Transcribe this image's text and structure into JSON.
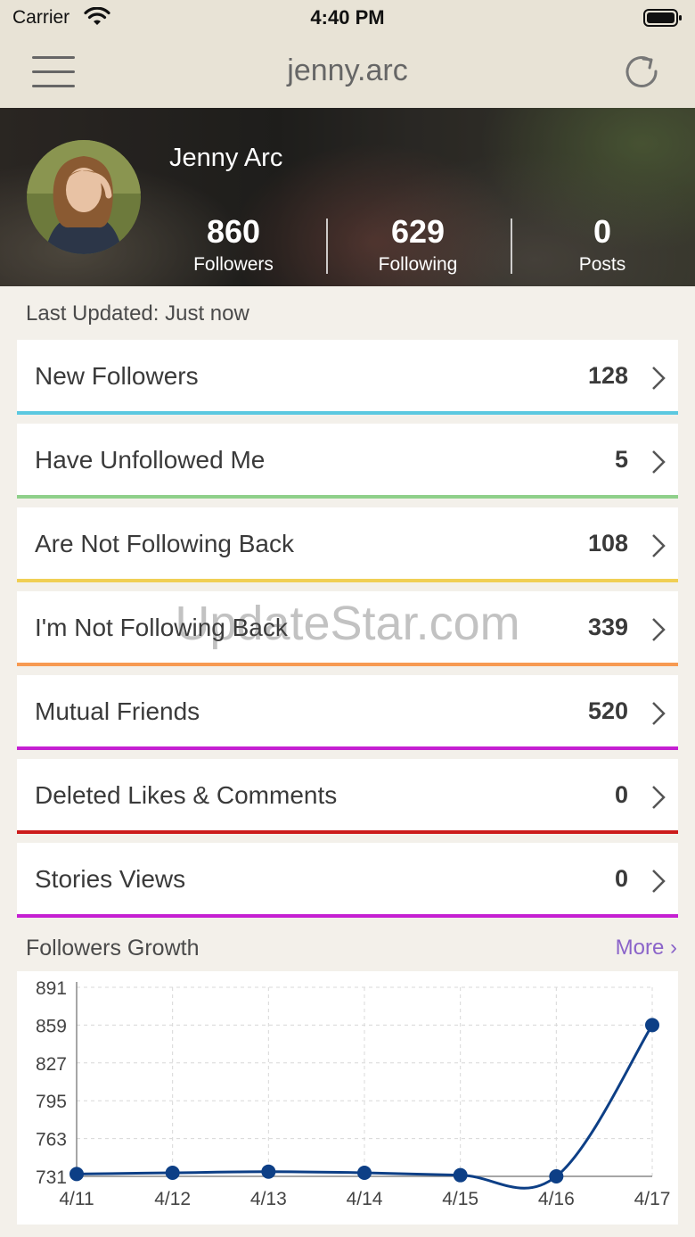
{
  "status_bar": {
    "carrier": "Carrier",
    "time": "4:40 PM"
  },
  "nav": {
    "title": "jenny.arc"
  },
  "profile": {
    "name": "Jenny Arc",
    "stats": [
      {
        "value": "860",
        "label": "Followers"
      },
      {
        "value": "629",
        "label": "Following"
      },
      {
        "value": "0",
        "label": "Posts"
      }
    ]
  },
  "last_updated": "Last Updated: Just now",
  "rows": [
    {
      "label": "New Followers",
      "count": "128",
      "color": "#5bc8e0"
    },
    {
      "label": "Have Unfollowed Me",
      "count": "5",
      "color": "#8fd08a"
    },
    {
      "label": "Are Not Following Back",
      "count": "108",
      "color": "#f0cf55"
    },
    {
      "label": "I'm Not Following Back",
      "count": "339",
      "color": "#f79a52"
    },
    {
      "label": "Mutual Friends",
      "count": "520",
      "color": "#c51fd2"
    },
    {
      "label": "Deleted Likes & Comments",
      "count": "0",
      "color": "#cc1b1b"
    },
    {
      "label": "Stories Views",
      "count": "0",
      "color": "#c51fd2"
    }
  ],
  "watermark": "UpdateStar.com",
  "growth": {
    "title": "Followers Growth",
    "more": "More ›"
  },
  "chart_data": {
    "type": "line",
    "categories": [
      "4/11",
      "4/12",
      "4/13",
      "4/14",
      "4/15",
      "4/16",
      "4/17"
    ],
    "values": [
      733,
      734,
      735,
      734,
      732,
      731,
      859
    ],
    "ylim": [
      731,
      891
    ],
    "yticks": [
      "891",
      "859",
      "827",
      "795",
      "763",
      "731"
    ],
    "grid": true,
    "line_color": "#0d3f86",
    "smooth": true
  }
}
